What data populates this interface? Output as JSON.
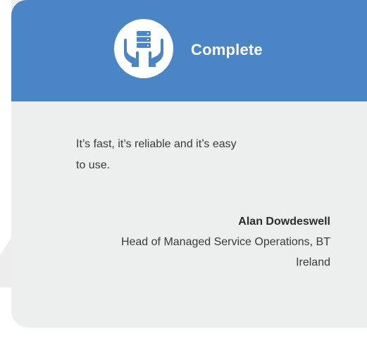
{
  "card": {
    "title": "Complete",
    "icon": "hands-holding-server-icon",
    "accent_color": "#4a86c5",
    "background_color": "#edeeee"
  },
  "testimonial": {
    "quote": "It’s fast, it’s reliable and it’s easy to use.",
    "author_name": "Alan Dowdeswell",
    "author_role": "Head of Managed Service Operations, BT Ireland"
  }
}
